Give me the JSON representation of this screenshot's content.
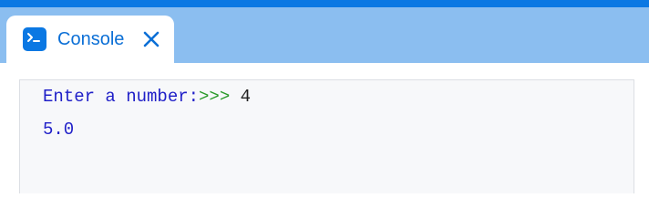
{
  "tab": {
    "label": "Console",
    "icon": "terminal-icon",
    "close_icon": "close-icon"
  },
  "console": {
    "lines": [
      {
        "prompt": "Enter a number:",
        "arrows": ">>>",
        "input": "4"
      },
      {
        "output": "5.0"
      }
    ]
  },
  "colors": {
    "top_stripe": "#0b78e3",
    "tab_bar": "#8bbef0",
    "accent": "#0b6fd6",
    "prompt": "#2020c8",
    "arrows": "#2a9a2a",
    "console_bg": "#f7f8fa"
  }
}
